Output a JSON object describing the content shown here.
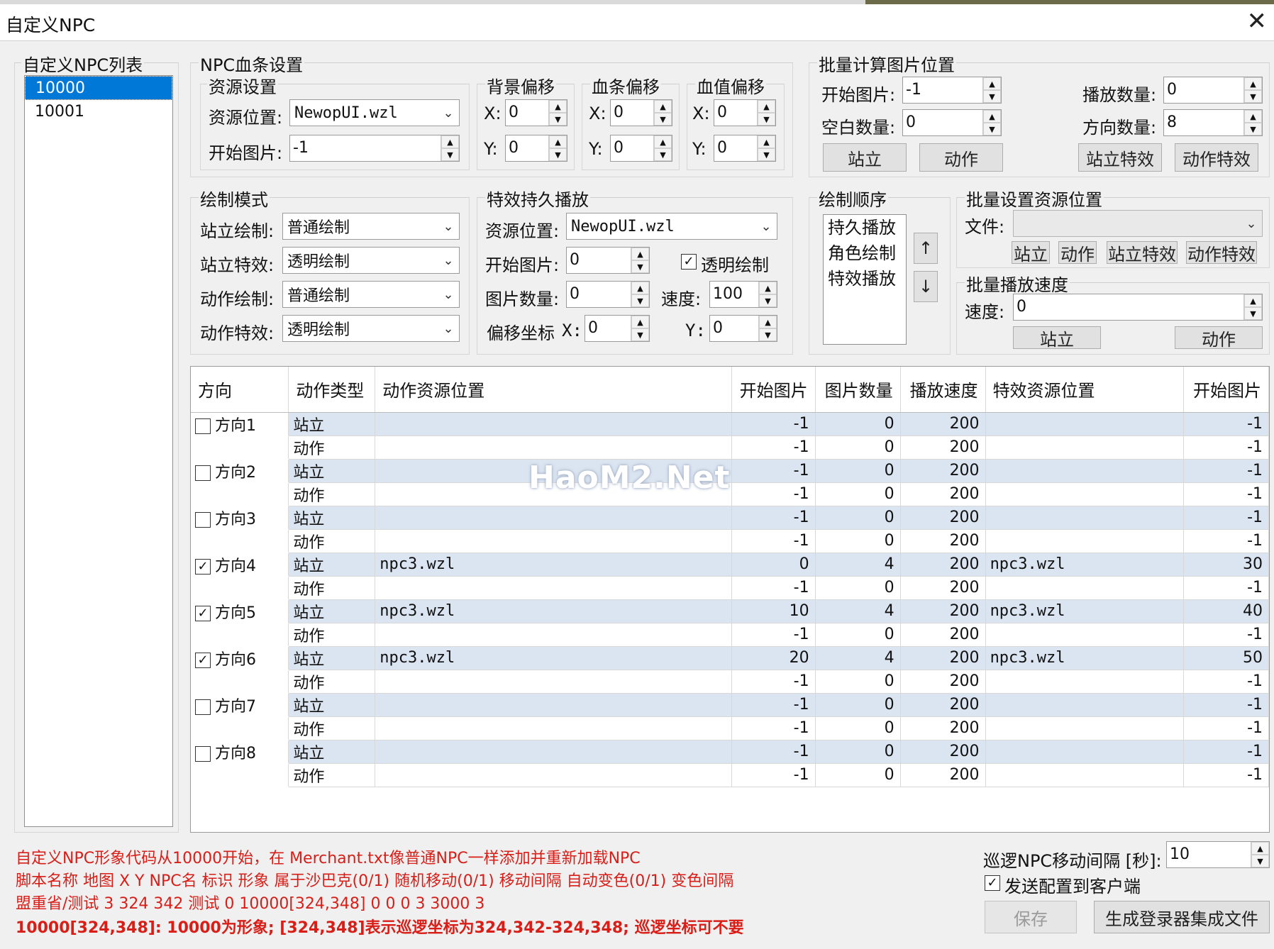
{
  "window": {
    "title": "自定义NPC",
    "close_glyph": "✕"
  },
  "npc_list": {
    "label": "自定义NPC列表",
    "items": [
      "10000",
      "10001"
    ],
    "selected": 0
  },
  "hp_bar": {
    "label": "NPC血条设置",
    "resource": {
      "label": "资源设置",
      "location_label": "资源位置:",
      "location_value": "NewopUI.wzl",
      "start_label": "开始图片:",
      "start_value": "-1"
    },
    "bg_offset": {
      "label": "背景偏移",
      "x_label": "X:",
      "x": "0",
      "y_label": "Y:",
      "y": "0"
    },
    "bar_offset": {
      "label": "血条偏移",
      "x_label": "X:",
      "x": "0",
      "y_label": "Y:",
      "y": "0"
    },
    "value_offset": {
      "label": "血值偏移",
      "x_label": "X:",
      "x": "0",
      "y_label": "Y:",
      "y": "0"
    }
  },
  "batch_calc": {
    "label": "批量计算图片位置",
    "start_label": "开始图片:",
    "start_value": "-1",
    "blank_label": "空白数量:",
    "blank_value": "0",
    "play_label": "播放数量:",
    "play_value": "0",
    "dir_label": "方向数量:",
    "dir_value": "8",
    "buttons": [
      "站立",
      "动作",
      "站立特效",
      "动作特效"
    ]
  },
  "draw_mode": {
    "label": "绘制模式",
    "rows": [
      {
        "label": "站立绘制:",
        "value": "普通绘制"
      },
      {
        "label": "站立特效:",
        "value": "透明绘制"
      },
      {
        "label": "动作绘制:",
        "value": "普通绘制"
      },
      {
        "label": "动作特效:",
        "value": "透明绘制"
      }
    ]
  },
  "effect_persist": {
    "label": "特效持久播放",
    "location_label": "资源位置:",
    "location_value": "NewopUI.wzl",
    "start_label": "开始图片:",
    "start_value": "0",
    "transparent_label": "透明绘制",
    "count_label": "图片数量:",
    "count_value": "0",
    "speed_label": "速度:",
    "speed_value": "100",
    "offset_label": "偏移坐标",
    "x_label": "X:",
    "x_value": "0",
    "y_label": "Y:",
    "y_value": "0"
  },
  "draw_order": {
    "label": "绘制顺序",
    "items": [
      "持久播放",
      "角色绘制",
      "特效播放"
    ],
    "up_glyph": "↑",
    "down_glyph": "↓"
  },
  "batch_resource": {
    "label": "批量设置资源位置",
    "file_label": "文件:",
    "file_value": "",
    "buttons": [
      "站立",
      "动作",
      "站立特效",
      "动作特效"
    ]
  },
  "batch_speed": {
    "label": "批量播放速度",
    "speed_label": "速度:",
    "speed_value": "0",
    "buttons": [
      "站立",
      "动作"
    ]
  },
  "table": {
    "columns": [
      "方向",
      "动作类型",
      "动作资源位置",
      "开始图片",
      "图片数量",
      "播放速度",
      "特效资源位置",
      "开始图片"
    ],
    "rows": [
      {
        "dir": "方向1",
        "checked": false,
        "type": "站立",
        "res": "",
        "start": "-1",
        "count": "0",
        "speed": "200",
        "fx": "",
        "fxstart": "-1"
      },
      {
        "dir": "",
        "type": "动作",
        "res": "",
        "start": "-1",
        "count": "0",
        "speed": "200",
        "fx": "",
        "fxstart": "-1"
      },
      {
        "dir": "方向2",
        "checked": false,
        "type": "站立",
        "res": "",
        "start": "-1",
        "count": "0",
        "speed": "200",
        "fx": "",
        "fxstart": "-1"
      },
      {
        "dir": "",
        "type": "动作",
        "res": "",
        "start": "-1",
        "count": "0",
        "speed": "200",
        "fx": "",
        "fxstart": "-1"
      },
      {
        "dir": "方向3",
        "checked": false,
        "type": "站立",
        "res": "",
        "start": "-1",
        "count": "0",
        "speed": "200",
        "fx": "",
        "fxstart": "-1"
      },
      {
        "dir": "",
        "type": "动作",
        "res": "",
        "start": "-1",
        "count": "0",
        "speed": "200",
        "fx": "",
        "fxstart": "-1"
      },
      {
        "dir": "方向4",
        "checked": true,
        "type": "站立",
        "res": "npc3.wzl",
        "start": "0",
        "count": "4",
        "speed": "200",
        "fx": "npc3.wzl",
        "fxstart": "30"
      },
      {
        "dir": "",
        "type": "动作",
        "res": "",
        "start": "-1",
        "count": "0",
        "speed": "200",
        "fx": "",
        "fxstart": "-1"
      },
      {
        "dir": "方向5",
        "checked": true,
        "type": "站立",
        "res": "npc3.wzl",
        "start": "10",
        "count": "4",
        "speed": "200",
        "fx": "npc3.wzl",
        "fxstart": "40"
      },
      {
        "dir": "",
        "type": "动作",
        "res": "",
        "start": "-1",
        "count": "0",
        "speed": "200",
        "fx": "",
        "fxstart": "-1"
      },
      {
        "dir": "方向6",
        "checked": true,
        "type": "站立",
        "res": "npc3.wzl",
        "start": "20",
        "count": "4",
        "speed": "200",
        "fx": "npc3.wzl",
        "fxstart": "50"
      },
      {
        "dir": "",
        "type": "动作",
        "res": "",
        "start": "-1",
        "count": "0",
        "speed": "200",
        "fx": "",
        "fxstart": "-1"
      },
      {
        "dir": "方向7",
        "checked": false,
        "type": "站立",
        "res": "",
        "start": "-1",
        "count": "0",
        "speed": "200",
        "fx": "",
        "fxstart": "-1"
      },
      {
        "dir": "",
        "type": "动作",
        "res": "",
        "start": "-1",
        "count": "0",
        "speed": "200",
        "fx": "",
        "fxstart": "-1"
      },
      {
        "dir": "方向8",
        "checked": false,
        "type": "站立",
        "res": "",
        "start": "-1",
        "count": "0",
        "speed": "200",
        "fx": "",
        "fxstart": "-1"
      },
      {
        "dir": "",
        "type": "动作",
        "res": "",
        "start": "-1",
        "count": "0",
        "speed": "200",
        "fx": "",
        "fxstart": "-1"
      }
    ]
  },
  "watermark": "HaoM2.Net",
  "notes": {
    "line1": "自定义NPC形象代码从10000开始，在 Merchant.txt像普通NPC一样添加并重新加载NPC",
    "line2": "脚本名称 地图 X Y NPC名 标识 形象 属于沙巴克(0/1) 随机移动(0/1) 移动间隔 自动变色(0/1) 变色间隔",
    "line3": "盟重省/测试 3 324 342 测试 0 10000[324,348] 0 0 0 3 3000 3",
    "line4": "10000[324,348]: 10000为形象; [324,348]表示巡逻坐标为324,342-324,348; 巡逻坐标可不要"
  },
  "patrol": {
    "label": "巡逻NPC移动间隔 [秒]:",
    "value": "10"
  },
  "send_config": {
    "label": "发送配置到客户端",
    "checked": true
  },
  "footer_buttons": {
    "save": "保存",
    "generate": "生成登录器集成文件"
  },
  "colors": {
    "selection": "#0078d7",
    "row_band": "#dbe5f1",
    "note_red": "#d91e18"
  }
}
